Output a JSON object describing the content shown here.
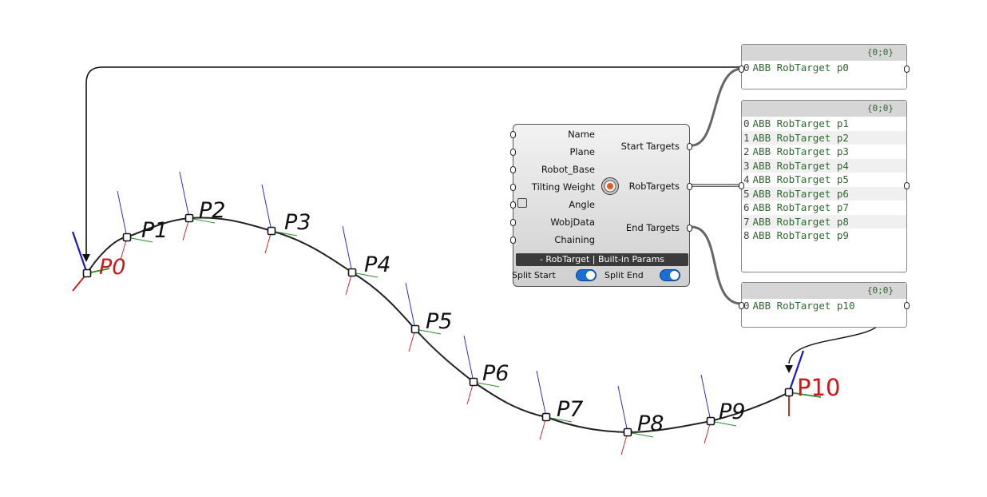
{
  "component": {
    "inputs": [
      "Name",
      "Plane",
      "Robot_Base",
      "Tilting Weight",
      "Angle",
      "WobjData",
      "Chaining"
    ],
    "outputs": [
      "Start Targets",
      "RobTargets",
      "End Targets"
    ],
    "title": "- RobTarget | Built-in Params",
    "toggles": [
      {
        "label": "Split Start",
        "on": true
      },
      {
        "label": "Split End",
        "on": true
      }
    ],
    "accent_color": "#1a6fd6",
    "dial_color": "#e55a1f"
  },
  "panels": [
    {
      "path": "{0;0}",
      "rows": [
        {
          "index": "0",
          "value": "ABB RobTarget p0"
        }
      ]
    },
    {
      "path": "{0;0}",
      "rows": [
        {
          "index": "0",
          "value": "ABB RobTarget p1"
        },
        {
          "index": "1",
          "value": "ABB RobTarget p2"
        },
        {
          "index": "2",
          "value": "ABB RobTarget p3"
        },
        {
          "index": "3",
          "value": "ABB RobTarget p4"
        },
        {
          "index": "4",
          "value": "ABB RobTarget p5"
        },
        {
          "index": "5",
          "value": "ABB RobTarget p6"
        },
        {
          "index": "6",
          "value": "ABB RobTarget p7"
        },
        {
          "index": "7",
          "value": "ABB RobTarget p8"
        },
        {
          "index": "8",
          "value": "ABB RobTarget p9"
        }
      ]
    },
    {
      "path": "{0;0}",
      "rows": [
        {
          "index": "0",
          "value": "ABB RobTarget p10"
        }
      ]
    }
  ],
  "points": [
    "P0",
    "P1",
    "P2",
    "P3",
    "P4",
    "P5",
    "P6",
    "P7",
    "P8",
    "P9",
    "P10"
  ],
  "colors": {
    "highlight": "#d0151a",
    "x_axis": "#d0151a",
    "y_axis": "#2b8a2b",
    "z_axis": "#1a1acc"
  }
}
